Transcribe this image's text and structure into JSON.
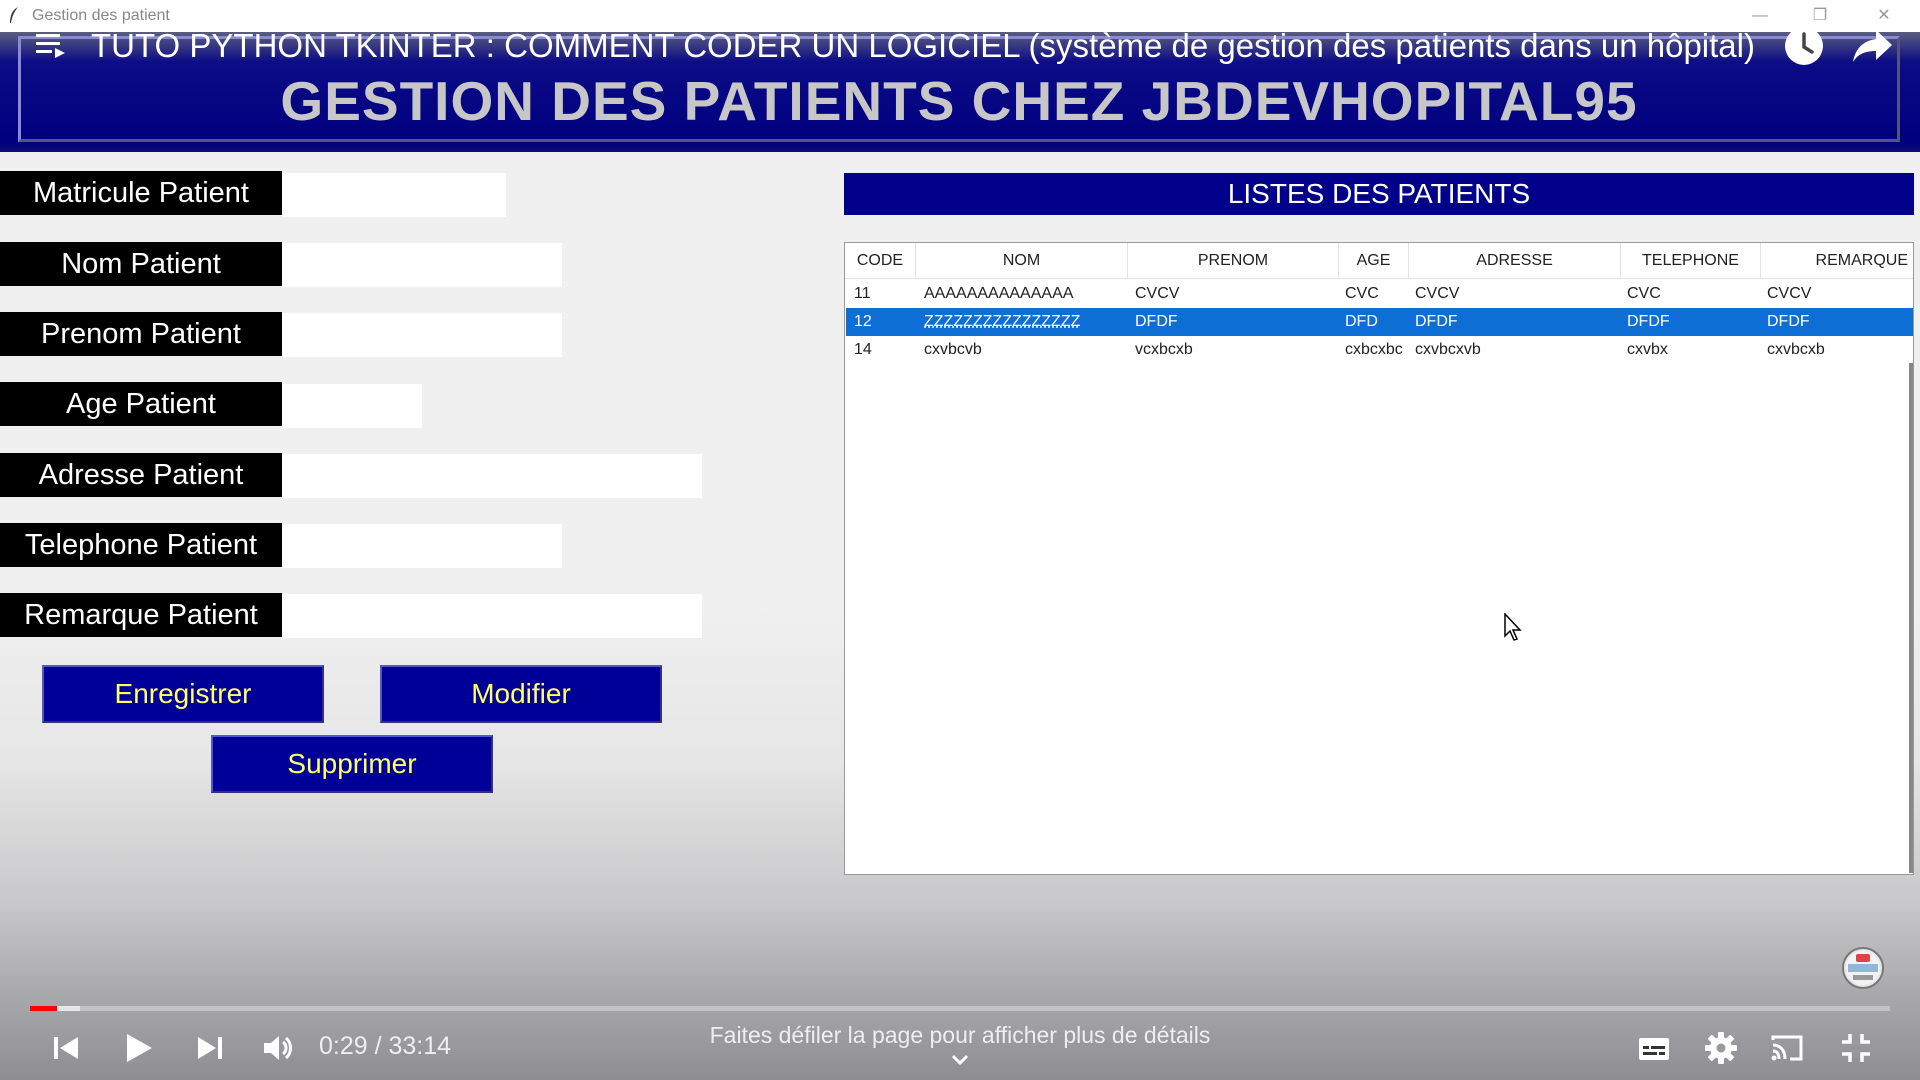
{
  "window": {
    "title": "Gestion des patient"
  },
  "video": {
    "title": "TUTO PYTHON TKINTER : COMMENT CODER UN LOGICIEL (système de gestion des patients dans un hôpital)",
    "current_time": "0:29",
    "duration": "33:14",
    "time_display": "0:29 / 33:14",
    "progress_fraction": 0.0146,
    "scroll_hint": "Faites défiler la page pour afficher plus de détails"
  },
  "app": {
    "main_title": "GESTION DES PATIENTS CHEZ JBDEVHOPITAL95",
    "form": {
      "labels": [
        "Matricule Patient",
        "Nom Patient",
        "Prenom Patient",
        "Age Patient",
        "Adresse Patient",
        "Telephone Patient",
        "Remarque Patient"
      ],
      "values": [
        "",
        "",
        "",
        "",
        "",
        "",
        ""
      ]
    },
    "buttons": {
      "save": "Enregistrer",
      "edit": "Modifier",
      "delete": "Supprimer"
    },
    "list": {
      "title": "LISTES DES PATIENTS",
      "columns": [
        "CODE",
        "NOM",
        "PRENOM",
        "AGE",
        "ADRESSE",
        "TELEPHONE",
        "REMARQUE"
      ],
      "rows": [
        [
          "11",
          "AAAAAAAAAAAAAA",
          "CVCV",
          "CVC",
          "CVCV",
          "CVC",
          "CVCV"
        ],
        [
          "12",
          "ZZZZZZZZZZZZZZZZ",
          "DFDF",
          "DFD",
          "DFDF",
          "DFDF",
          "DFDF"
        ],
        [
          "14",
          "cxvbcvb",
          "vcxbcxb",
          "cxbcxbc",
          "cxvbcxvb",
          "cxvbx",
          "cxvbcxb"
        ]
      ],
      "selected_row": 1
    }
  },
  "colors": {
    "banner": "#000080",
    "button_bg": "#000099",
    "button_text": "#ffff66",
    "selection": "#0d6fd6",
    "progress": "#ff0000"
  },
  "icons": {
    "playlist": "playlist-icon",
    "watch_later": "clock-icon",
    "share": "share-icon",
    "previous": "skip-previous-icon",
    "play": "play-icon",
    "next": "skip-next-icon",
    "volume": "volume-icon",
    "subtitles": "subtitles-icon",
    "settings": "gear-icon",
    "cast": "cast-icon",
    "exit_fullscreen": "exit-fullscreen-icon"
  }
}
